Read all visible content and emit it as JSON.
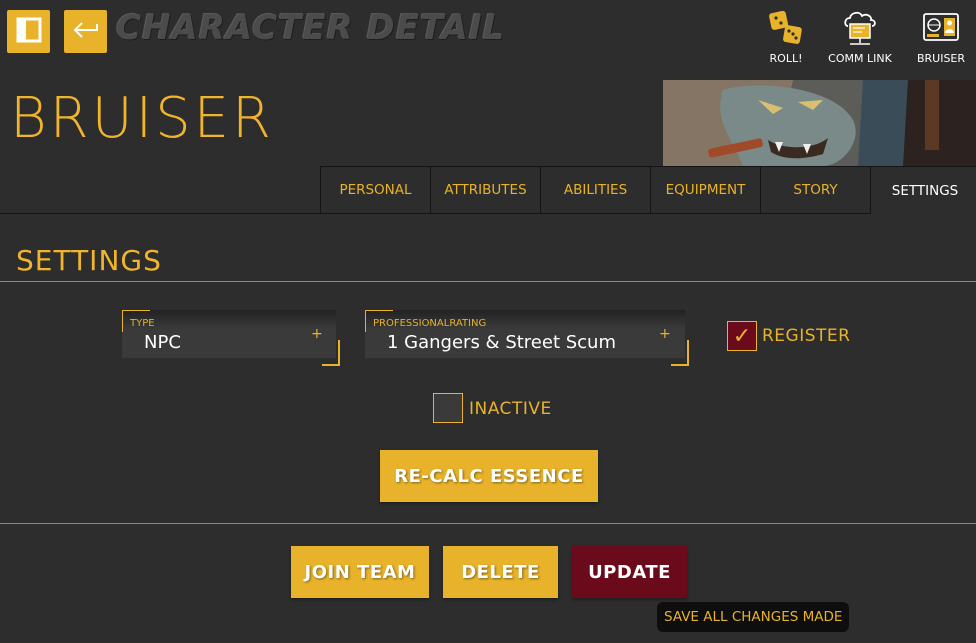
{
  "header": {
    "app_title": "CHARACTER DETAIL",
    "sidebar_toggle_icon": "sidebar-toggle-icon",
    "back_icon": "back-arrow-icon",
    "actions": [
      {
        "label": "ROLL!",
        "icon": "dice-icon"
      },
      {
        "label": "COMM LINK",
        "icon": "comm-link-icon"
      },
      {
        "label": "BRUISER",
        "icon": "character-id-icon"
      }
    ]
  },
  "character": {
    "name": "BRUISER"
  },
  "tabs": [
    {
      "label": "PERSONAL"
    },
    {
      "label": "ATTRIBUTES"
    },
    {
      "label": "ABILITIES"
    },
    {
      "label": "EQUIPMENT"
    },
    {
      "label": "STORY"
    },
    {
      "label": "SETTINGS",
      "active": true
    }
  ],
  "settings": {
    "title": "SETTINGS",
    "type": {
      "label": "TYPE",
      "value": "NPC",
      "plus": "+"
    },
    "professional_rating": {
      "label": "PROFESSIONALRATING",
      "value": "1 Gangers & Street Scum",
      "plus": "+"
    },
    "register": {
      "label": "REGISTER",
      "checked": true,
      "mark": "✓"
    },
    "inactive": {
      "label": "INACTIVE",
      "checked": false
    },
    "recalc_label": "RE-CALC ESSENCE"
  },
  "footer": {
    "join_team_label": "JOIN TEAM",
    "delete_label": "DELETE",
    "update_label": "UPDATE",
    "tooltip": "SAVE ALL CHANGES MADE"
  },
  "colors": {
    "accent": "#e8b32a",
    "background": "#2d2d2e",
    "danger": "#6b0a1a"
  }
}
